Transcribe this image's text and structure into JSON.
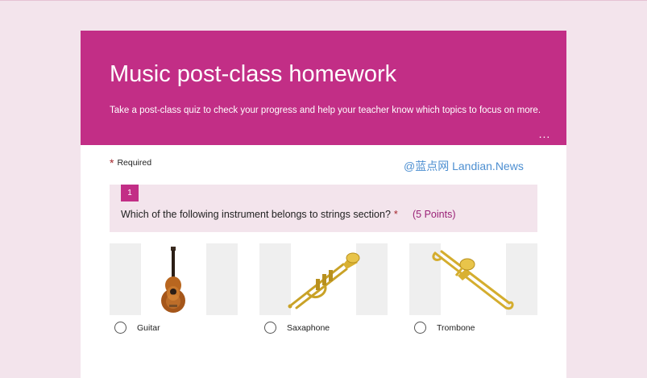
{
  "form": {
    "title": "Music post-class homework",
    "subtitle": "Take a post-class quiz to check your progress and help your teacher know which topics to focus on more.",
    "more_label": "...",
    "required_star": "*",
    "required_label": "Required"
  },
  "watermark": "@蓝点网 Landian.News",
  "question": {
    "number": "1",
    "text": "Which of the following instrument belongs to strings section?",
    "required_star": "*",
    "points": "(5 Points)",
    "options": [
      {
        "label": "Guitar",
        "icon": "guitar-icon"
      },
      {
        "label": "Saxaphone",
        "icon": "trumpet-icon"
      },
      {
        "label": "Trombone",
        "icon": "trombone-icon"
      }
    ]
  },
  "colors": {
    "page_background": "#f3e4ec",
    "brand": "#c22e86",
    "required_star": "#a4262c",
    "points": "#9a2277",
    "watermark": "#4d8fd1"
  }
}
